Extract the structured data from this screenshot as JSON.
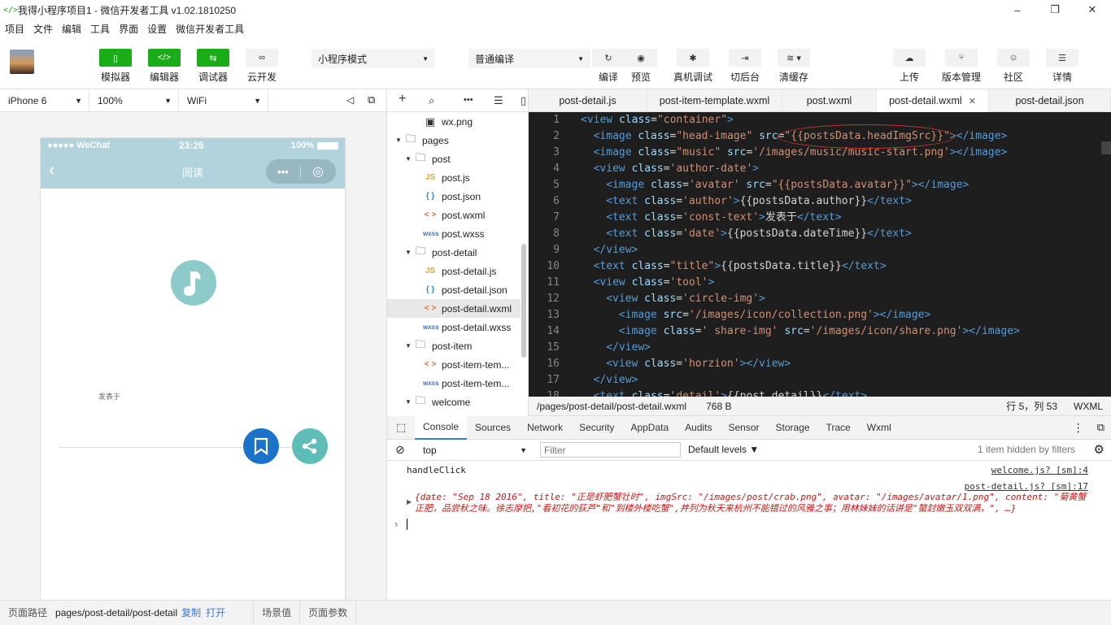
{
  "window": {
    "title": "我得小程序项目1 - 微信开发者工具 v1.02.1810250",
    "controls": [
      "–",
      "❐",
      "✕"
    ]
  },
  "menu": [
    "项目",
    "文件",
    "编辑",
    "工具",
    "界面",
    "设置",
    "微信开发者工具"
  ],
  "toolbar": {
    "left": [
      {
        "label": "模拟器",
        "icon": "phone-icon"
      },
      {
        "label": "编辑器",
        "icon": "code-icon"
      },
      {
        "label": "调试器",
        "icon": "debug-icon"
      },
      {
        "label": "云开发",
        "icon": "cloud-icon"
      }
    ],
    "mode_select": "小程序模式",
    "compile_select": "普通编译",
    "right_a": [
      {
        "label": "编译",
        "icon": "refresh-icon"
      },
      {
        "label": "预览",
        "icon": "eye-icon"
      },
      {
        "label": "真机调试",
        "icon": "bug-icon"
      },
      {
        "label": "切后台",
        "icon": "switch-icon"
      },
      {
        "label": "清缓存",
        "icon": "stack-icon"
      }
    ],
    "right_b": [
      {
        "label": "上传",
        "icon": "upload-icon"
      },
      {
        "label": "版本管理",
        "icon": "branch-icon"
      },
      {
        "label": "社区",
        "icon": "chat-icon"
      },
      {
        "label": "详情",
        "icon": "menu-icon"
      }
    ]
  },
  "device": {
    "model": "iPhone 6",
    "zoom": "100%",
    "network": "WiFi"
  },
  "phone": {
    "signal": "●●●●● WeChat",
    "time": "23:26",
    "battery": "100%",
    "nav_title": "阅读",
    "capsule_more": "•••",
    "publish_text": "发表于",
    "accent_color": "#b3d3dc"
  },
  "filetree": {
    "rows": [
      {
        "name": "wx.png",
        "type": "img",
        "depth": 2
      },
      {
        "name": "pages",
        "type": "folder",
        "depth": 0,
        "open": true
      },
      {
        "name": "post",
        "type": "folder",
        "depth": 1,
        "open": true
      },
      {
        "name": "post.js",
        "type": "js",
        "depth": 2
      },
      {
        "name": "post.json",
        "type": "json",
        "depth": 2
      },
      {
        "name": "post.wxml",
        "type": "wxml",
        "depth": 2
      },
      {
        "name": "post.wxss",
        "type": "wxss",
        "depth": 2
      },
      {
        "name": "post-detail",
        "type": "folder",
        "depth": 1,
        "open": true
      },
      {
        "name": "post-detail.js",
        "type": "js",
        "depth": 2
      },
      {
        "name": "post-detail.json",
        "type": "json",
        "depth": 2
      },
      {
        "name": "post-detail.wxml",
        "type": "wxml",
        "depth": 2,
        "selected": true
      },
      {
        "name": "post-detail.wxss",
        "type": "wxss",
        "depth": 2
      },
      {
        "name": "post-item",
        "type": "folder",
        "depth": 1,
        "open": true
      },
      {
        "name": "post-item-tem...",
        "type": "wxml",
        "depth": 2
      },
      {
        "name": "post-item-tem...",
        "type": "wxss",
        "depth": 2
      },
      {
        "name": "welcome",
        "type": "folder",
        "depth": 1,
        "open": true
      }
    ]
  },
  "tabs": [
    {
      "label": "post-detail.js",
      "width": 146
    },
    {
      "label": "post-item-template.wxml",
      "width": 166
    },
    {
      "label": "post.wxml",
      "width": 116
    },
    {
      "label": "post-detail.wxml",
      "width": 138,
      "active": true
    },
    {
      "label": "post-detail.json",
      "width": 150
    }
  ],
  "code_lines": [
    {
      "n": "1",
      "indent": 0,
      "parts": [
        [
          "tg",
          "<view "
        ],
        [
          "at",
          "class"
        ],
        [
          "tx",
          "="
        ],
        [
          "st",
          "\"container\""
        ],
        [
          "tg",
          ">"
        ]
      ]
    },
    {
      "n": "2",
      "indent": 1,
      "parts": [
        [
          "tg",
          "<image "
        ],
        [
          "at",
          "class"
        ],
        [
          "tx",
          "="
        ],
        [
          "st",
          "\"head-image\" "
        ],
        [
          "at",
          "src"
        ],
        [
          "tx",
          "="
        ],
        [
          "st",
          "\"{{postsData.headImgSrc}}\""
        ],
        [
          "tg",
          "></image>"
        ]
      ]
    },
    {
      "n": "3",
      "indent": 1,
      "parts": [
        [
          "tg",
          "<image "
        ],
        [
          "at",
          "class"
        ],
        [
          "tx",
          "="
        ],
        [
          "st",
          "\"music\" "
        ],
        [
          "at",
          "src"
        ],
        [
          "tx",
          "="
        ],
        [
          "st",
          "'/images/music/music-start.png'"
        ],
        [
          "tg",
          "></image>"
        ]
      ]
    },
    {
      "n": "4",
      "indent": 1,
      "parts": [
        [
          "tg",
          "<view "
        ],
        [
          "at",
          "class"
        ],
        [
          "tx",
          "="
        ],
        [
          "st",
          "'author-date'"
        ],
        [
          "tg",
          ">"
        ]
      ]
    },
    {
      "n": "5",
      "indent": 2,
      "parts": [
        [
          "tg",
          "<image "
        ],
        [
          "at",
          "class"
        ],
        [
          "tx",
          "="
        ],
        [
          "st",
          "'avatar' "
        ],
        [
          "at",
          "src"
        ],
        [
          "tx",
          "="
        ],
        [
          "st",
          "\"{{postsData.avatar}}\""
        ],
        [
          "tg",
          "></image>"
        ]
      ]
    },
    {
      "n": "6",
      "indent": 2,
      "parts": [
        [
          "tg",
          "<text "
        ],
        [
          "at",
          "class"
        ],
        [
          "tx",
          "="
        ],
        [
          "st",
          "'author'"
        ],
        [
          "tg",
          ">"
        ],
        [
          "tx",
          "{{postsData.author}}"
        ],
        [
          "tg",
          "</text>"
        ]
      ]
    },
    {
      "n": "7",
      "indent": 2,
      "parts": [
        [
          "tg",
          "<text "
        ],
        [
          "at",
          "class"
        ],
        [
          "tx",
          "="
        ],
        [
          "st",
          "'const-text'"
        ],
        [
          "tg",
          ">"
        ],
        [
          "tx",
          "发表于"
        ],
        [
          "tg",
          "</text>"
        ]
      ]
    },
    {
      "n": "8",
      "indent": 2,
      "parts": [
        [
          "tg",
          "<text "
        ],
        [
          "at",
          "class"
        ],
        [
          "tx",
          "="
        ],
        [
          "st",
          "'date'"
        ],
        [
          "tg",
          ">"
        ],
        [
          "tx",
          "{{postsData.dateTime}}"
        ],
        [
          "tg",
          "</text>"
        ]
      ]
    },
    {
      "n": "9",
      "indent": 1,
      "parts": [
        [
          "tg",
          "</view>"
        ]
      ]
    },
    {
      "n": "10",
      "indent": 1,
      "parts": [
        [
          "tg",
          "<text "
        ],
        [
          "at",
          "class"
        ],
        [
          "tx",
          "="
        ],
        [
          "st",
          "\"title\""
        ],
        [
          "tg",
          ">"
        ],
        [
          "tx",
          "{{postsData.title}}"
        ],
        [
          "tg",
          "</text>"
        ]
      ]
    },
    {
      "n": "11",
      "indent": 1,
      "parts": [
        [
          "tg",
          "<view "
        ],
        [
          "at",
          "class"
        ],
        [
          "tx",
          "="
        ],
        [
          "st",
          "'tool'"
        ],
        [
          "tg",
          ">"
        ]
      ]
    },
    {
      "n": "12",
      "indent": 2,
      "parts": [
        [
          "tg",
          "<view "
        ],
        [
          "at",
          "class"
        ],
        [
          "tx",
          "="
        ],
        [
          "st",
          "'circle-img'"
        ],
        [
          "tg",
          ">"
        ]
      ]
    },
    {
      "n": "13",
      "indent": 3,
      "parts": [
        [
          "tg",
          "<image "
        ],
        [
          "at",
          "src"
        ],
        [
          "tx",
          "="
        ],
        [
          "st",
          "'/images/icon/collection.png'"
        ],
        [
          "tg",
          "></image>"
        ]
      ]
    },
    {
      "n": "14",
      "indent": 3,
      "parts": [
        [
          "tg",
          "<image "
        ],
        [
          "at",
          "class"
        ],
        [
          "tx",
          "="
        ],
        [
          "st",
          "' share-img' "
        ],
        [
          "at",
          "src"
        ],
        [
          "tx",
          "="
        ],
        [
          "st",
          "'/images/icon/share.png'"
        ],
        [
          "tg",
          "></image>"
        ]
      ]
    },
    {
      "n": "15",
      "indent": 2,
      "parts": [
        [
          "tg",
          "</view>"
        ]
      ]
    },
    {
      "n": "16",
      "indent": 2,
      "parts": [
        [
          "tg",
          "<view "
        ],
        [
          "at",
          "class"
        ],
        [
          "tx",
          "="
        ],
        [
          "st",
          "'horzion'"
        ],
        [
          "tg",
          "></view>"
        ]
      ]
    },
    {
      "n": "17",
      "indent": 1,
      "parts": [
        [
          "tg",
          "</view>"
        ]
      ]
    },
    {
      "n": "18",
      "indent": 1,
      "parts": [
        [
          "tg",
          "<text "
        ],
        [
          "at",
          "class"
        ],
        [
          "tx",
          "="
        ],
        [
          "st",
          "'detail'"
        ],
        [
          "tg",
          ">"
        ],
        [
          "tx",
          "{{post.detail}}"
        ],
        [
          "tg",
          "</text>"
        ]
      ]
    }
  ],
  "editor_status": {
    "path": "/pages/post-detail/post-detail.wxml",
    "size": "768 B",
    "cursor": "行 5，列 53",
    "lang": "WXML"
  },
  "devtools_tabs": [
    "Console",
    "Sources",
    "Network",
    "Security",
    "AppData",
    "Audits",
    "Sensor",
    "Storage",
    "Trace",
    "Wxml"
  ],
  "console_bar": {
    "context": "top",
    "filter_placeholder": "Filter",
    "levels": "Default levels ▼",
    "hidden_note": "1 item hidden by filters"
  },
  "console": {
    "log1": "handleClick",
    "src1": "welcome.js? [sm]:4",
    "src2": "post-detail.js? [sm]:17",
    "obj_line1": "{date: \"Sep 18 2016\", title: \"正是虾肥蟹壮时\", imgSrc: \"/images/post/crab.png\", avatar: \"/images/avatar/1.png\", content: \"菊黄蟹",
    "obj_line2": "正肥，品尝秋之味。徐志摩把,\"看初花的荻芦\"和\"到楼外楼吃蟹\",并列为秋天来杭州不能错过的风雅之事；用林妹妹的话讲是\"螯封嫩玉双双满，\", …}"
  },
  "statusbar": {
    "path_label": "页面路径",
    "path": "pages/post-detail/post-detail",
    "copy": "复制",
    "open": "打开",
    "scene": "场景值",
    "params": "页面参数"
  }
}
